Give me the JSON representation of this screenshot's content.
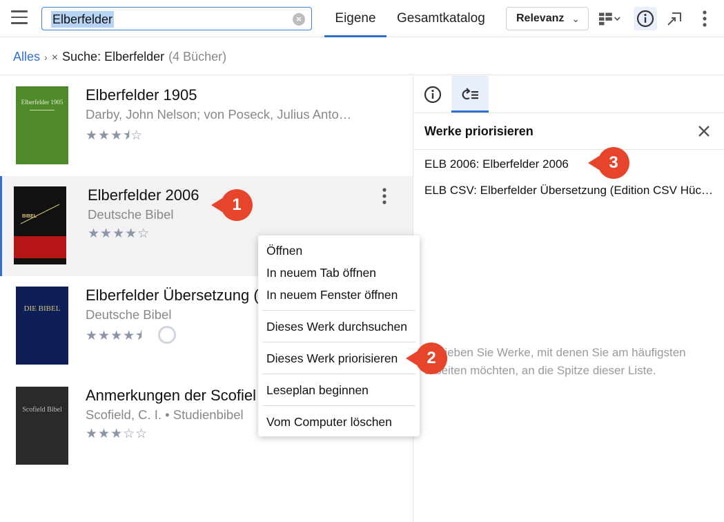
{
  "search": {
    "value": "Elberfelder"
  },
  "tabs": {
    "own": "Eigene",
    "catalog": "Gesamtkatalog"
  },
  "sort": {
    "label": "Relevanz"
  },
  "breadcrumb": {
    "root": "Alles",
    "query": "Suche: Elberfelder",
    "count": "(4 Bücher)"
  },
  "books": [
    {
      "title": "Elberfelder 1905",
      "author": "Darby, John Nelson; von Poseck, Julius Anto…",
      "stars": "★★★⯨☆",
      "cover_color": "#4f8a2a",
      "cover_text": "Elberfelder 1905"
    },
    {
      "title": "Elberfelder 2006",
      "author": "Deutsche Bibel",
      "stars": "★★★★☆",
      "cover_color": "#111111",
      "cover_text": "BIBEL"
    },
    {
      "title": "Elberfelder Übersetzung (",
      "author": "Deutsche Bibel",
      "stars": "★★★★⯨",
      "cover_color": "#0e1f57",
      "cover_text": "DIE BIBEL"
    },
    {
      "title": "Anmerkungen der Scofiel",
      "author": "Scofield, C. I. • Studienbibel",
      "stars": "★★★☆☆",
      "cover_color": "#2a2a2a",
      "cover_text": "Scofield Bibel"
    }
  ],
  "context_menu": {
    "items": [
      "Öffnen",
      "In neuem Tab öffnen",
      "In neuem Fenster öffnen",
      "Dieses Werk durchsuchen",
      "Dieses Werk priorisieren",
      "Leseplan beginnen",
      "Vom Computer löschen"
    ]
  },
  "panel": {
    "title": "Werke priorisieren",
    "items": [
      "ELB 2006: Elberfelder 2006",
      "ELB CSV: Elberfelder Übersetzung (Edition CSV Hückeswagen)"
    ],
    "hint": "Schieben Sie Werke, mit denen Sie am häufigsten arbeiten möchten, an die Spitze dieser Liste."
  },
  "callouts": [
    "1",
    "2",
    "3"
  ],
  "colors": {
    "accent": "#2f6fd0",
    "callout": "#e6452b"
  }
}
